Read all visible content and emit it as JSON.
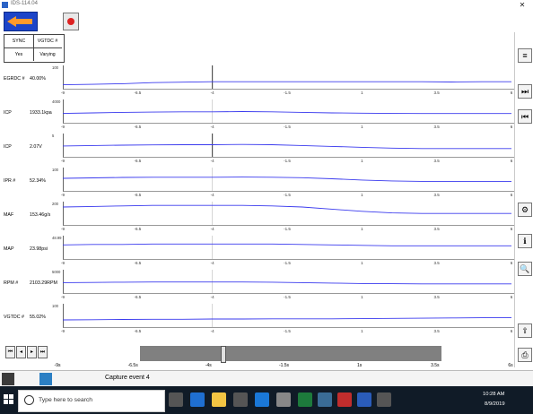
{
  "window": {
    "title": "IDS-114.04"
  },
  "sync": {
    "col1_header": "SYNC",
    "col2_header": "VGTDC #",
    "col1_value": "Yes",
    "col2_value": "Varying"
  },
  "panels": [
    {
      "label": "EGRDC #",
      "value": "40.00%",
      "ymax": "100"
    },
    {
      "label": "ICP",
      "value": "1933.1kpa",
      "ymax": "4000"
    },
    {
      "label": "ICP",
      "value": "2.07V",
      "ymax": "5"
    },
    {
      "label": "IPR #",
      "value": "52.34%",
      "ymax": "100"
    },
    {
      "label": "MAF",
      "value": "153.46g/s",
      "ymax": "200"
    },
    {
      "label": "MAP",
      "value": "23.98psi",
      "ymax": "48.99"
    },
    {
      "label": "RPM #",
      "value": "2103.29RPM",
      "ymax": "5000"
    },
    {
      "label": "VGTDC #",
      "value": "55.02%",
      "ymax": "100"
    }
  ],
  "panel_ticks": [
    "-9",
    "-6.5",
    "-4",
    "-1.5",
    "1",
    "3.5",
    "6"
  ],
  "time_axis": [
    "-9s",
    "-6.5s",
    "-4s",
    "-1.5s",
    "1s",
    "3.5s",
    "6s"
  ],
  "chart_data": {
    "type": "line",
    "x": [
      -9,
      -8,
      -7,
      -6,
      -5,
      -4,
      -3,
      -2,
      -1,
      0,
      1,
      2,
      3,
      4,
      5,
      6
    ],
    "series": [
      {
        "name": "EGRDC #",
        "values": [
          10,
          12,
          15,
          20,
          22,
          24,
          24,
          24,
          24,
          24,
          24,
          24,
          24,
          23,
          24,
          24
        ]
      },
      {
        "name": "ICP",
        "values": [
          1400,
          1500,
          1600,
          1650,
          1700,
          1700,
          1750,
          1700,
          1600,
          1500,
          1450,
          1400,
          1380,
          1380,
          1380,
          1380
        ]
      },
      {
        "name": "ICP",
        "values": [
          2.1,
          2.2,
          2.3,
          2.35,
          2.4,
          2.4,
          2.45,
          2.4,
          2.2,
          2.0,
          1.8,
          1.6,
          1.5,
          1.5,
          1.5,
          1.5
        ]
      },
      {
        "name": "IPR #",
        "values": [
          50,
          52,
          54,
          55,
          55,
          55,
          56,
          55,
          53,
          48,
          42,
          38,
          36,
          36,
          36,
          36
        ]
      },
      {
        "name": "MAF",
        "values": [
          150,
          155,
          160,
          165,
          165,
          165,
          165,
          160,
          150,
          130,
          110,
          95,
          90,
          90,
          90,
          90
        ]
      },
      {
        "name": "MAP",
        "values": [
          28,
          29,
          29,
          30,
          30,
          30,
          30,
          30,
          29,
          28,
          27,
          26,
          26,
          26,
          26,
          26
        ]
      },
      {
        "name": "RPM #",
        "values": [
          2000,
          2050,
          2100,
          2150,
          2150,
          2150,
          2150,
          2100,
          2000,
          1900,
          1800,
          1750,
          1700,
          1700,
          1700,
          1700
        ]
      },
      {
        "name": "VGTDC #",
        "values": [
          25,
          26,
          27,
          28,
          28,
          29,
          29,
          30,
          30,
          30,
          31,
          32,
          33,
          34,
          35,
          36
        ]
      }
    ],
    "xlim": [
      -9,
      6
    ],
    "cursor_x": -4
  },
  "status": {
    "text": "Capture event 4"
  },
  "taskbar": {
    "search_placeholder": "Type here to search",
    "time": "10:28 AM",
    "date": "8/9/2019"
  },
  "colors": {
    "trace": "#3a3aee",
    "taskbar": "#101b27",
    "scroll_track": "#808080"
  },
  "icons": [
    "close-icon",
    "back-icon",
    "record-icon",
    "menu-icon",
    "skip-end-icon",
    "skip-start-icon",
    "info-icon",
    "search-icon",
    "windows-logo",
    "edge-icon",
    "excel-icon"
  ]
}
